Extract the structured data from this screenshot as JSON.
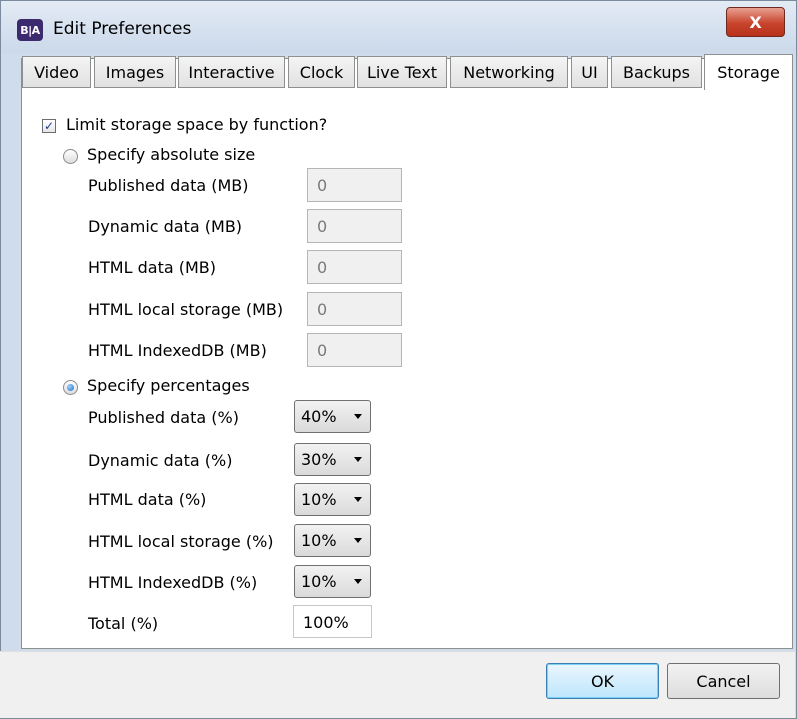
{
  "window": {
    "icon_text": "B|A",
    "title": "Edit Preferences",
    "close_label": "X"
  },
  "tabs": [
    {
      "label": "Video"
    },
    {
      "label": "Images"
    },
    {
      "label": "Interactive"
    },
    {
      "label": "Clock"
    },
    {
      "label": "Live Text"
    },
    {
      "label": "Networking"
    },
    {
      "label": "UI"
    },
    {
      "label": "Backups"
    },
    {
      "label": "Storage",
      "active": true
    }
  ],
  "storage": {
    "limit_checkbox": {
      "label": "Limit storage space by function?",
      "checked": true
    },
    "absolute": {
      "radio_label": "Specify absolute size",
      "selected": false,
      "fields": [
        {
          "label": "Published data (MB)",
          "value": "0"
        },
        {
          "label": "Dynamic data (MB)",
          "value": "0"
        },
        {
          "label": "HTML data (MB)",
          "value": "0"
        },
        {
          "label": "HTML local storage (MB)",
          "value": "0"
        },
        {
          "label": "HTML IndexedDB (MB)",
          "value": "0"
        }
      ]
    },
    "percentages": {
      "radio_label": "Specify percentages",
      "selected": true,
      "fields": [
        {
          "label": "Published data (%)",
          "value": "40%"
        },
        {
          "label": "Dynamic data (%)",
          "value": "30%"
        },
        {
          "label": "HTML data (%)",
          "value": "10%"
        },
        {
          "label": "HTML local storage (%)",
          "value": "10%"
        },
        {
          "label": "HTML IndexedDB (%)",
          "value": "10%"
        }
      ],
      "total_label": "Total (%)",
      "total_value": "100%"
    }
  },
  "buttons": {
    "ok": "OK",
    "cancel": "Cancel"
  },
  "colors": {
    "title_bar": "#cbd9ea",
    "close_button": "#c8442c",
    "ok_button_border": "#3c7fb1",
    "radio_selected": "#1f6fc5"
  }
}
